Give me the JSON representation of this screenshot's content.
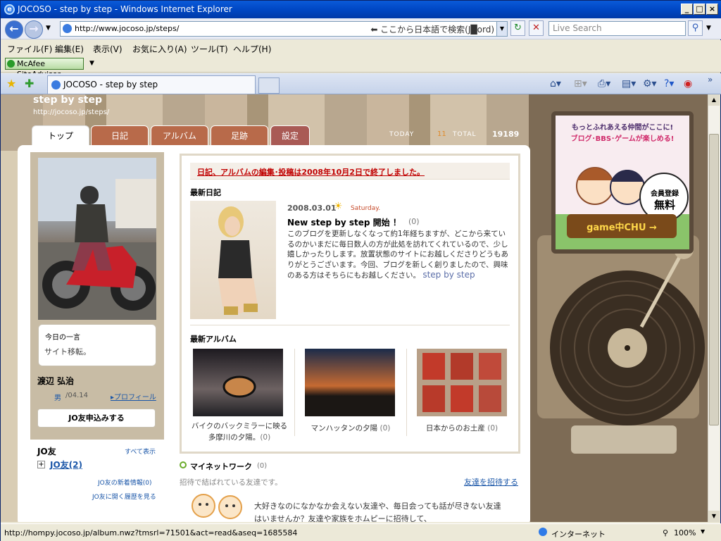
{
  "window": {
    "title": "JOCOSO - step by step - Windows Internet Explorer"
  },
  "nav": {
    "url": "http://www.jocoso.jp/steps/",
    "hint": "⬅ ここから日本語で検索(J█ord)",
    "search_placeholder": "Live Search"
  },
  "menu": [
    "ファイル(F)",
    "編集(E)",
    "表示(V)",
    "お気に入り(A)",
    "ツール(T)",
    "ヘルプ(H)"
  ],
  "mcafee": {
    "label": "McAfee SiteAdvisor"
  },
  "tab": {
    "title": "JOCOSO - step by step"
  },
  "site": {
    "title": "step by step",
    "url": "http://jocoso.jp/steps/",
    "tabs": [
      "トップ",
      "日記",
      "アルバム",
      "足跡",
      "設定"
    ],
    "today_label": "TODAY",
    "today_value": "11",
    "total_label": "TOTAL",
    "total_value": "19189"
  },
  "profile": {
    "comment_label": "今日の一言",
    "comment": "サイト移転。",
    "name": "渡辺 弘治",
    "gender": "男",
    "birthday": "/04.14",
    "profile_link": "▸プロフィール",
    "jo_button": "JO友申込みする",
    "jo_header": "JO友",
    "see_all": "すべて表示",
    "jo_count": "JO友(2)",
    "new_info": "JO友の新着情報(0)",
    "history": "JO友に開く履歴を見る"
  },
  "notice": "日記、アルバムの編集･投稿は2008年10月2日で終了しました。",
  "diary": {
    "section": "最新日記",
    "date": "2008.03.01",
    "day": "Saturday.",
    "title": "New step by step 開始 ！",
    "count": "(0)",
    "body": "このブログを更新しなくなって約1年経ちますが、どこから来ているのかいまだに毎日数人の方が此処を訪れてくれているので、少し嬉しかったりします。放置状態のサイトにお越しくださりどうもありがとうございます。今回、ブログを新しく創りましたので、興味のある方はそちらにもお越しください。",
    "link": "step by step"
  },
  "album": {
    "section": "最新アルバム",
    "items": [
      {
        "caption": "バイクのバックミラーに映る多摩川の夕陽。",
        "count": "(0)"
      },
      {
        "caption": "マンハッタンの夕陽",
        "count": "(0)"
      },
      {
        "caption": "日本からのお土産",
        "count": "(0)"
      }
    ]
  },
  "network": {
    "title": "マイネットワーク",
    "count": "(0)",
    "sub": "招待で結ばれている友達です。",
    "invite": "友達を招待する",
    "body": "大好きなのになかなか会えない友達や、毎日会っても話が尽きない友達はいませんか？友達や家族をホムピーに招待して、"
  },
  "ad": {
    "line1": "もっとふれあえる仲間がここに!",
    "line2": "ブログ･BBS･ゲームが楽しめる!",
    "badge1": "会員登録",
    "badge2": "無料",
    "logo": "game中CHU →"
  },
  "status": {
    "url": "http://hompy.jocoso.jp/album.nwz?tmsrl=71501&act=read&aseq=1685584",
    "zone": "インターネット",
    "zoom": "100%"
  },
  "colors": {
    "accent": "#c00000",
    "tab_active": "#ffffff",
    "tab_inactive": "#b86a4a",
    "link": "#1a56a8"
  }
}
